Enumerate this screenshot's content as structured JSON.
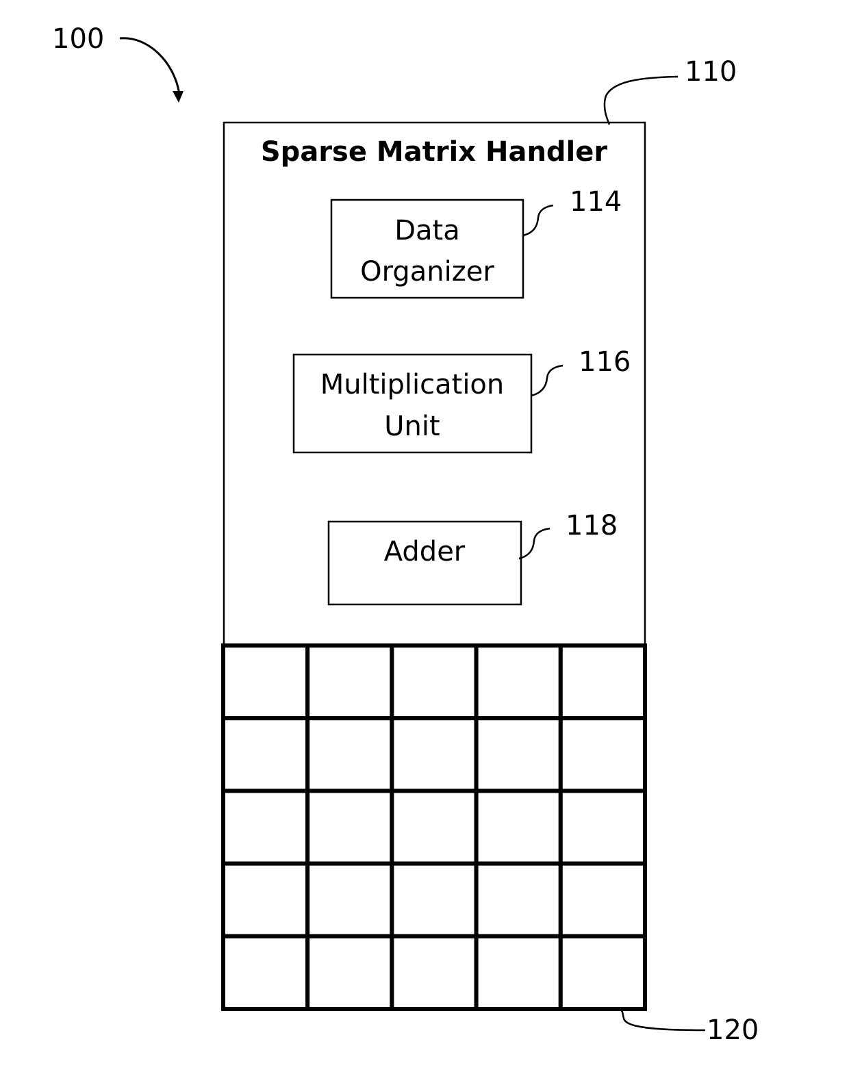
{
  "figure": {
    "system_ref": "100",
    "handler": {
      "ref": "110",
      "title": "Sparse Matrix Handler",
      "components": [
        {
          "ref": "114",
          "lines": [
            "Data",
            "Organizer"
          ]
        },
        {
          "ref": "116",
          "lines": [
            "Multiplication",
            "Unit"
          ]
        },
        {
          "ref": "118",
          "lines": [
            "Adder"
          ]
        }
      ]
    },
    "array": {
      "ref": "120",
      "rows": 5,
      "cols": 5
    }
  },
  "colors": {
    "stroke": "#000000",
    "background": "#ffffff"
  }
}
